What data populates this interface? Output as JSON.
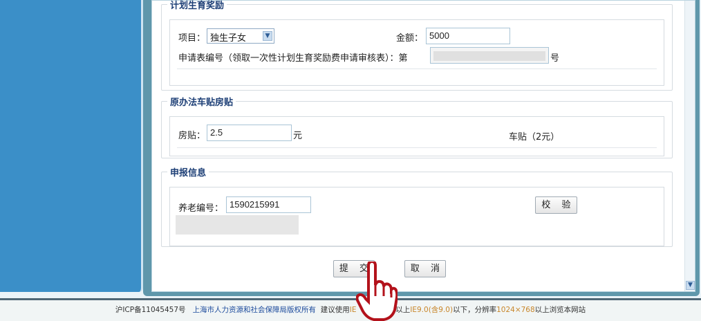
{
  "family_planning": {
    "legend": "计划生育奖励",
    "item_label": "项目：",
    "item_value": "独生子女",
    "amount_label": "金额：",
    "amount_value": "5000",
    "form_no_label": "申请表编号（领取一次性计划生育奖励费申请审核表）：第",
    "form_no_suffix": "号"
  },
  "subsidy": {
    "legend": "原办法车贴房贴",
    "housing_label": "房贴：",
    "housing_value": "2.5",
    "housing_unit": "元",
    "car_label": "车贴（2元）"
  },
  "declaration": {
    "legend": "申报信息",
    "pension_label": "养老编号：",
    "pension_value": "1590215991",
    "verify_button": "校 验"
  },
  "actions": {
    "submit": "提 交",
    "cancel": "取 消"
  },
  "footer": {
    "icp": "沪ICP备11045457号",
    "copyright": "上海市人力资源和社会保障局版权所有",
    "advice_prefix": "建议使用",
    "ie_low": "IE",
    "ie_low_tail": "0)以上",
    "ie_high": "IE9.0(含9.0)",
    "mid": "以下，分辨率",
    "resolution": "1024×768",
    "tail": "以上浏览本网站"
  }
}
